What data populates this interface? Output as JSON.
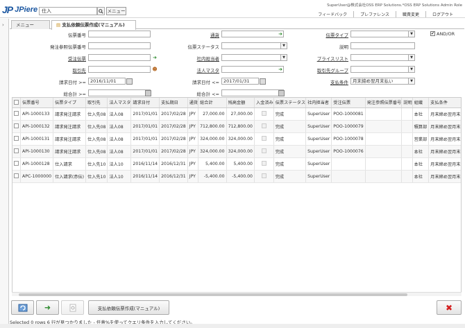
{
  "app": {
    "logo_mark": "JP",
    "logo_text": "JPiere",
    "search_value": "仕入",
    "menu_button": "メニュー",
    "user_info": "SuperUser@株式会社OSS ERP Solutions.*OSS ERP Solutions Admin Role",
    "top_links": [
      "フィードバック",
      "プレファレンス",
      "職責変更",
      "ログアウト"
    ]
  },
  "tabs": [
    {
      "label": "メニュー (219)"
    },
    {
      "label": "支払依頼伝票作成(マニュアル)",
      "close": "✖"
    }
  ],
  "criteria": {
    "doc_no_label": "伝票番号",
    "ref_doc_no_label": "発注参照伝票番号",
    "order_doc_label": "受注伝票",
    "partner_label": "取引先",
    "date_from_label": "請求日付 >=",
    "date_from_value": "2016/11/01",
    "total_from_label": "総合計 >=",
    "currency_label": "通貨",
    "doc_status_label": "伝票ステータス",
    "sales_rep_label": "社内担当者",
    "org_label": "法人マスタ",
    "date_to_label": "請求日付 <=",
    "date_to_value": "2017/01/31",
    "total_to_label": "総合計 <=",
    "doc_type_label": "伝票タイプ",
    "description_label": "説明",
    "price_list_label": "プライスリスト",
    "partner_group_label": "取引先グループ",
    "payment_term_label": "支払条件",
    "payment_term_value": "月末締め翌月末払い",
    "and_or_label": "AND/OR",
    "and_or_checked": "✔"
  },
  "grid": {
    "columns": [
      "伝票番号",
      "伝票タイプ",
      "取引先",
      "法人マスタ",
      "請求日付",
      "支払期日",
      "通貨",
      "総合計",
      "残高金額",
      "入金済み",
      "伝票ステータス",
      "社内担当者",
      "受注伝票",
      "発注参照伝票番号",
      "説明",
      "組織",
      "支払条件"
    ],
    "rows": [
      [
        "API-1000133",
        "請求発注請求",
        "仕入先08",
        "法人08",
        "2017/01/01",
        "2017/02/28",
        "JPY",
        "27,000.00",
        "27,000.00",
        "",
        "完成",
        "SuperUser",
        "POO-1000081",
        "",
        "",
        "本社",
        "月末締め翌月末払い"
      ],
      [
        "API-1000132",
        "請求発注請求",
        "仕入先08",
        "法人08",
        "2017/01/01",
        "2017/02/28",
        "JPY",
        "712,800.00",
        "712,800.00",
        "",
        "完成",
        "SuperUser",
        "POO-1000079",
        "",
        "",
        "積算部",
        "月末締め翌月末払い"
      ],
      [
        "API-1000131",
        "請求発注請求",
        "仕入先08",
        "法人08",
        "2017/01/01",
        "2017/02/28",
        "JPY",
        "324,000.00",
        "324,000.00",
        "",
        "完成",
        "SuperUser",
        "POO-1000078",
        "",
        "",
        "営業部",
        "月末締め翌月末払い"
      ],
      [
        "API-1000130",
        "請求発注請求",
        "仕入先08",
        "法人08",
        "2017/01/01",
        "2017/02/28",
        "JPY",
        "324,000.00",
        "324,000.00",
        "",
        "完成",
        "SuperUser",
        "POO-1000076",
        "",
        "",
        "本社",
        "月末締め翌月末払い"
      ],
      [
        "API-1000128",
        "仕入請求",
        "仕入先10",
        "法人10",
        "2016/11/14",
        "2016/12/31",
        "JPY",
        "5,400.00",
        "5,400.00",
        "",
        "完成",
        "SuperUser",
        "",
        "",
        "",
        "本社",
        "月末締め翌月末払い"
      ],
      [
        "APC-1000000",
        "仕入請求(赤伝)",
        "仕入先10",
        "法人10",
        "2016/11/14",
        "2016/12/31",
        "JPY",
        "-5,400.00",
        "-5,400.00",
        "",
        "完成",
        "SuperUser",
        "",
        "",
        "",
        "本社",
        "月末締め翌月末払い"
      ]
    ]
  },
  "bottom": {
    "process_button": "支払依頼伝票作成(マニュアル)",
    "status_text": "Selected 0 rows   6 行が見つかりました - 任意%を使ってクエリ条件を入力してください。"
  },
  "colors": {
    "brand": "#1a56a0",
    "zoom_green": "#2e8b2e",
    "cancel_red": "#d42020"
  }
}
